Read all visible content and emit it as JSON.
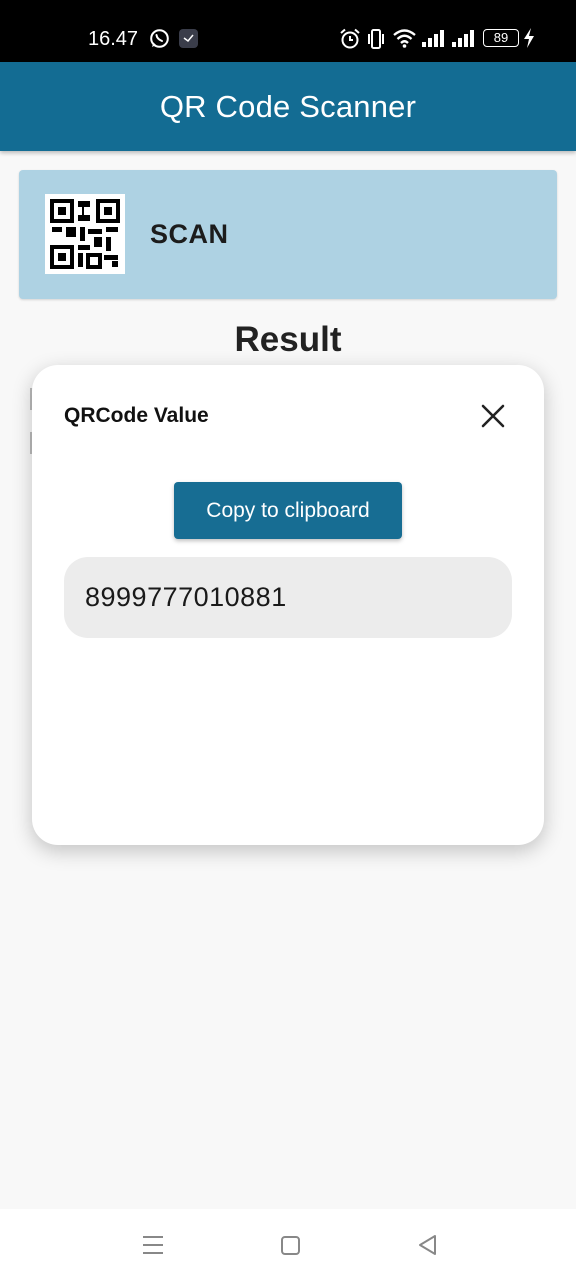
{
  "status_bar": {
    "time": "16.47",
    "battery": "89",
    "icons": [
      "whatsapp-icon",
      "clock-app-icon",
      "alarm-icon",
      "vibrate-icon",
      "wifi-icon",
      "signal-icon",
      "signal-icon",
      "battery-icon",
      "charging-icon"
    ]
  },
  "app_bar": {
    "title": "QR Code Scanner"
  },
  "scan_card": {
    "label": "SCAN",
    "icon": "qr-code-icon"
  },
  "result": {
    "heading": "Result"
  },
  "dialog": {
    "title": "QRCode Value",
    "copy_label": "Copy to clipboard",
    "value": "8999777010881",
    "close_icon": "close-icon"
  },
  "nav_bar": {
    "icons": [
      "menu-icon",
      "home-icon",
      "back-icon"
    ]
  },
  "colors": {
    "primary": "#136c93",
    "scan_card_bg": "#aed2e3",
    "value_bg": "#ececec",
    "page_bg": "#f8f8f8"
  }
}
